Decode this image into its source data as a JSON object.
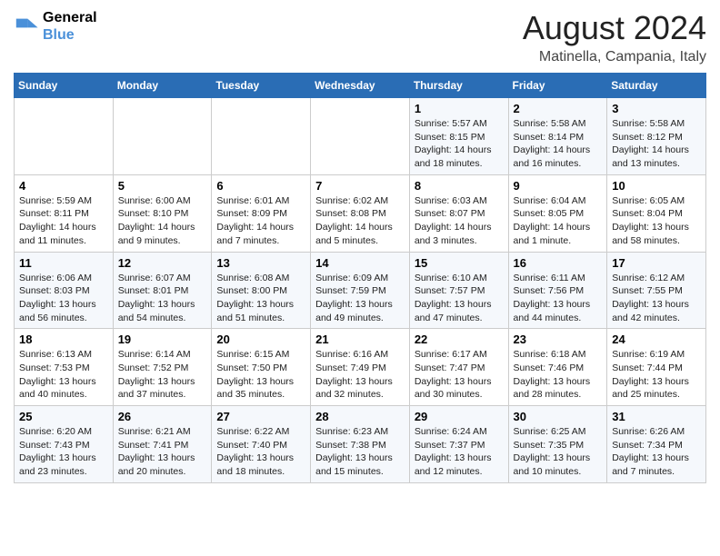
{
  "logo": {
    "line1": "General",
    "line2": "Blue"
  },
  "title": "August 2024",
  "location": "Matinella, Campania, Italy",
  "weekdays": [
    "Sunday",
    "Monday",
    "Tuesday",
    "Wednesday",
    "Thursday",
    "Friday",
    "Saturday"
  ],
  "weeks": [
    [
      {
        "day": "",
        "info": ""
      },
      {
        "day": "",
        "info": ""
      },
      {
        "day": "",
        "info": ""
      },
      {
        "day": "",
        "info": ""
      },
      {
        "day": "1",
        "info": "Sunrise: 5:57 AM\nSunset: 8:15 PM\nDaylight: 14 hours\nand 18 minutes."
      },
      {
        "day": "2",
        "info": "Sunrise: 5:58 AM\nSunset: 8:14 PM\nDaylight: 14 hours\nand 16 minutes."
      },
      {
        "day": "3",
        "info": "Sunrise: 5:58 AM\nSunset: 8:12 PM\nDaylight: 14 hours\nand 13 minutes."
      }
    ],
    [
      {
        "day": "4",
        "info": "Sunrise: 5:59 AM\nSunset: 8:11 PM\nDaylight: 14 hours\nand 11 minutes."
      },
      {
        "day": "5",
        "info": "Sunrise: 6:00 AM\nSunset: 8:10 PM\nDaylight: 14 hours\nand 9 minutes."
      },
      {
        "day": "6",
        "info": "Sunrise: 6:01 AM\nSunset: 8:09 PM\nDaylight: 14 hours\nand 7 minutes."
      },
      {
        "day": "7",
        "info": "Sunrise: 6:02 AM\nSunset: 8:08 PM\nDaylight: 14 hours\nand 5 minutes."
      },
      {
        "day": "8",
        "info": "Sunrise: 6:03 AM\nSunset: 8:07 PM\nDaylight: 14 hours\nand 3 minutes."
      },
      {
        "day": "9",
        "info": "Sunrise: 6:04 AM\nSunset: 8:05 PM\nDaylight: 14 hours\nand 1 minute."
      },
      {
        "day": "10",
        "info": "Sunrise: 6:05 AM\nSunset: 8:04 PM\nDaylight: 13 hours\nand 58 minutes."
      }
    ],
    [
      {
        "day": "11",
        "info": "Sunrise: 6:06 AM\nSunset: 8:03 PM\nDaylight: 13 hours\nand 56 minutes."
      },
      {
        "day": "12",
        "info": "Sunrise: 6:07 AM\nSunset: 8:01 PM\nDaylight: 13 hours\nand 54 minutes."
      },
      {
        "day": "13",
        "info": "Sunrise: 6:08 AM\nSunset: 8:00 PM\nDaylight: 13 hours\nand 51 minutes."
      },
      {
        "day": "14",
        "info": "Sunrise: 6:09 AM\nSunset: 7:59 PM\nDaylight: 13 hours\nand 49 minutes."
      },
      {
        "day": "15",
        "info": "Sunrise: 6:10 AM\nSunset: 7:57 PM\nDaylight: 13 hours\nand 47 minutes."
      },
      {
        "day": "16",
        "info": "Sunrise: 6:11 AM\nSunset: 7:56 PM\nDaylight: 13 hours\nand 44 minutes."
      },
      {
        "day": "17",
        "info": "Sunrise: 6:12 AM\nSunset: 7:55 PM\nDaylight: 13 hours\nand 42 minutes."
      }
    ],
    [
      {
        "day": "18",
        "info": "Sunrise: 6:13 AM\nSunset: 7:53 PM\nDaylight: 13 hours\nand 40 minutes."
      },
      {
        "day": "19",
        "info": "Sunrise: 6:14 AM\nSunset: 7:52 PM\nDaylight: 13 hours\nand 37 minutes."
      },
      {
        "day": "20",
        "info": "Sunrise: 6:15 AM\nSunset: 7:50 PM\nDaylight: 13 hours\nand 35 minutes."
      },
      {
        "day": "21",
        "info": "Sunrise: 6:16 AM\nSunset: 7:49 PM\nDaylight: 13 hours\nand 32 minutes."
      },
      {
        "day": "22",
        "info": "Sunrise: 6:17 AM\nSunset: 7:47 PM\nDaylight: 13 hours\nand 30 minutes."
      },
      {
        "day": "23",
        "info": "Sunrise: 6:18 AM\nSunset: 7:46 PM\nDaylight: 13 hours\nand 28 minutes."
      },
      {
        "day": "24",
        "info": "Sunrise: 6:19 AM\nSunset: 7:44 PM\nDaylight: 13 hours\nand 25 minutes."
      }
    ],
    [
      {
        "day": "25",
        "info": "Sunrise: 6:20 AM\nSunset: 7:43 PM\nDaylight: 13 hours\nand 23 minutes."
      },
      {
        "day": "26",
        "info": "Sunrise: 6:21 AM\nSunset: 7:41 PM\nDaylight: 13 hours\nand 20 minutes."
      },
      {
        "day": "27",
        "info": "Sunrise: 6:22 AM\nSunset: 7:40 PM\nDaylight: 13 hours\nand 18 minutes."
      },
      {
        "day": "28",
        "info": "Sunrise: 6:23 AM\nSunset: 7:38 PM\nDaylight: 13 hours\nand 15 minutes."
      },
      {
        "day": "29",
        "info": "Sunrise: 6:24 AM\nSunset: 7:37 PM\nDaylight: 13 hours\nand 12 minutes."
      },
      {
        "day": "30",
        "info": "Sunrise: 6:25 AM\nSunset: 7:35 PM\nDaylight: 13 hours\nand 10 minutes."
      },
      {
        "day": "31",
        "info": "Sunrise: 6:26 AM\nSunset: 7:34 PM\nDaylight: 13 hours\nand 7 minutes."
      }
    ]
  ]
}
